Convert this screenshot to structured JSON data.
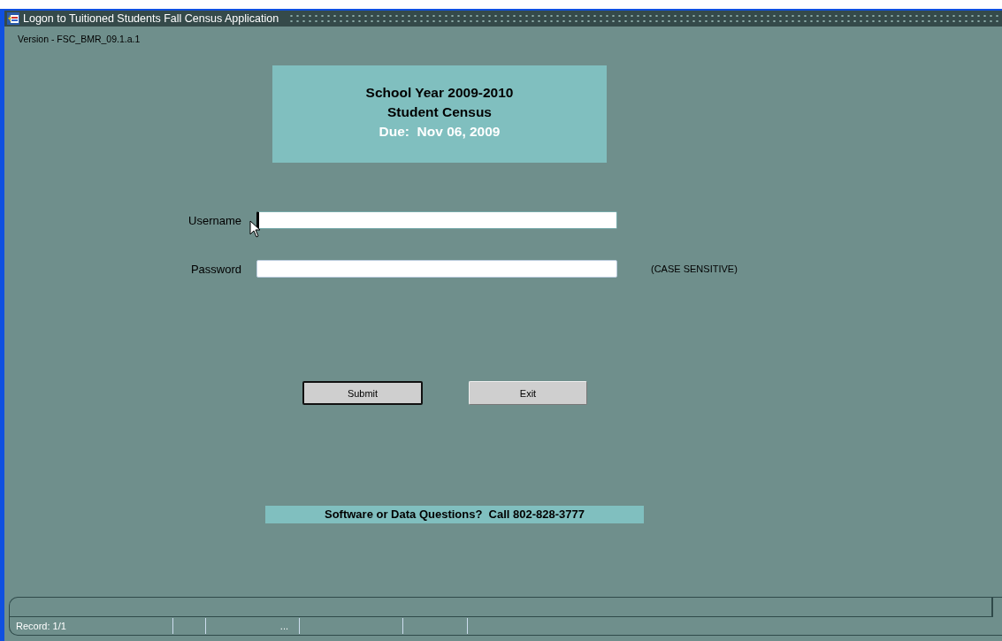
{
  "window": {
    "title": "Logon to Tuitioned Students Fall Census Application"
  },
  "version": "Version - FSC_BMR_09.1.a.1",
  "banner": {
    "lines": [
      "School Year 2009-2010",
      "Student Census"
    ],
    "due": "Due:  Nov 06, 2009"
  },
  "fields": [
    {
      "label": "Username",
      "focused": true
    },
    {
      "label": "Password",
      "note": "(CASE SENSITIVE)",
      "focused": false
    }
  ],
  "buttons": [
    {
      "label": "Submit",
      "selected": true
    },
    {
      "label": "Exit",
      "selected": false
    }
  ],
  "contact": "Software or Data Questions?  Call 802-828-3777",
  "status_bar": {
    "record": "Record: 1/1",
    "indicator": "..."
  }
}
